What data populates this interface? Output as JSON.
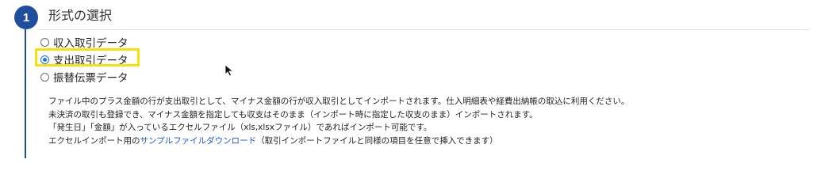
{
  "step": {
    "number": "1",
    "title": "形式の選択"
  },
  "options": [
    {
      "label": "収入取引データ",
      "checked": false
    },
    {
      "label": "支出取引データ",
      "checked": true
    },
    {
      "label": "振替伝票データ",
      "checked": false
    }
  ],
  "description": {
    "line1": "ファイル中のプラス金額の行が支出取引として、マイナス金額の行が収入取引としてインポートされます。仕入明細表や経費出納帳の取込に利用ください。",
    "line2": "未決済の取引も登録でき、マイナス金額を指定しても収支はそのまま（インポート時に指定した収支のまま）インポートされます。",
    "line3": "「発生日」「金額」が入っているエクセルファイル（xls,xlsxファイル）であればインポート可能です。",
    "line4_prefix": "エクセルインポート用の",
    "line4_link": "サンプルファイルダウンロード",
    "line4_suffix": "（取引インポートファイルと同様の項目を任意で挿入できます）"
  },
  "colors": {
    "accent": "#1f4e9c",
    "highlight": "#f6e20a",
    "link": "#1a56c9"
  },
  "icons": {
    "cursor": "mouse-pointer-icon"
  }
}
